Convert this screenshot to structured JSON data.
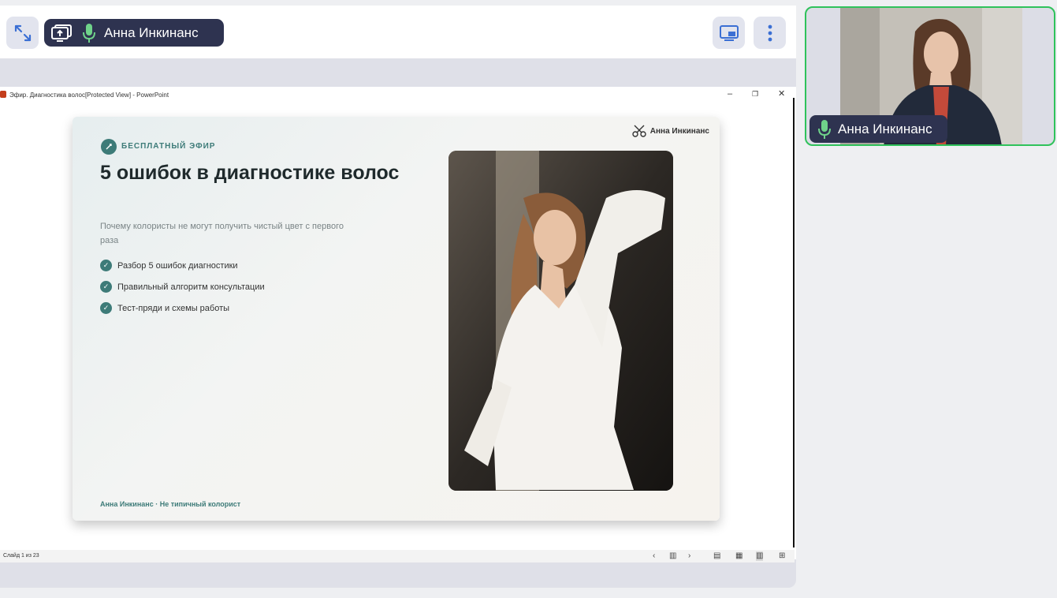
{
  "toolbar": {
    "speaker_name": "Анна Инкинанс"
  },
  "window": {
    "title": "Эфир. Диагностика волос[Protected View] - PowerPoint",
    "minimize": "–",
    "restore": "❐",
    "close": "✕"
  },
  "slide": {
    "badge": "БЕСПЛАТНЫЙ ЭФИР",
    "title": "5 ошибок в диагностике волос",
    "subtitle": "Почему колористы не могут получить чистый цвет с первого раза",
    "checklist": [
      {
        "label": "Разбор 5 ошибок диагностики"
      },
      {
        "label": "Правильный алгоритм консультации"
      },
      {
        "label": "Тест-пряди и схемы работы"
      }
    ],
    "check_mark": "✓",
    "brand": "Анна Инкинанс",
    "footer": "Анна Инкинанс · Не типичный колорист"
  },
  "statusbar": {
    "slide_counter": "Слайд 1 из 23",
    "prev": "‹",
    "next": "›"
  },
  "participant": {
    "name": "Анна Инкинанс"
  },
  "colors": {
    "accent_teal": "#3d7b78",
    "active_speaker_border": "#2fc25b",
    "pill_bg": "#2e3350",
    "mic_green": "#6fd38a"
  },
  "icons": [
    "collapse-icon",
    "screen-share-icon",
    "mic-icon",
    "layout-icon",
    "more-icon",
    "powerpoint-icon",
    "scissors-logo-icon",
    "check-icon"
  ]
}
